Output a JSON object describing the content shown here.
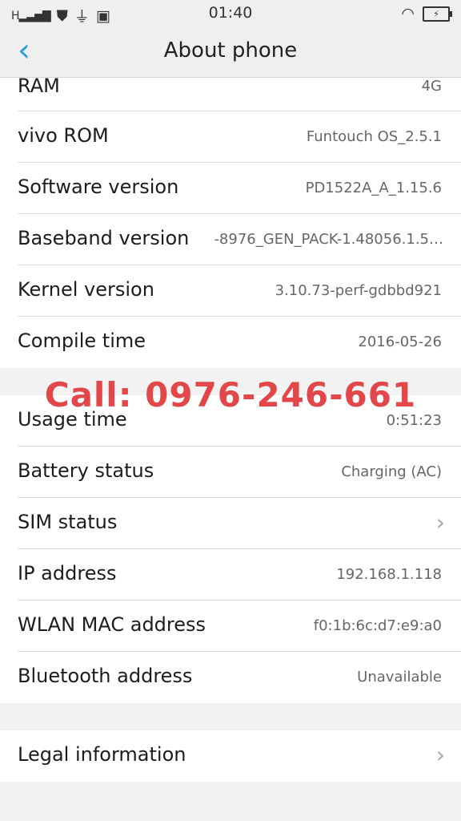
{
  "status_bar": {
    "signal_text": "H",
    "time": "01:40",
    "icons": [
      "signal-icon",
      "shield-icon",
      "usb-icon",
      "battery-saver-icon",
      "wifi-icon",
      "battery-charging-icon"
    ]
  },
  "header": {
    "title": "About phone",
    "back_icon": "chevron-left-icon"
  },
  "rows_top": [
    {
      "label": "RAM",
      "value": "4G"
    },
    {
      "label": "vivo ROM",
      "value": "Funtouch OS_2.5.1"
    },
    {
      "label": "Software version",
      "value": "PD1522A_A_1.15.6"
    },
    {
      "label": "Baseband version",
      "value": "-8976_GEN_PACK-1.48056.1.5…"
    },
    {
      "label": "Kernel version",
      "value": "3.10.73-perf-gdbbd921"
    },
    {
      "label": "Compile time",
      "value": "2016-05-26"
    }
  ],
  "overlay_text": "Call: 0976-246-661",
  "rows_mid": [
    {
      "label": "Usage time",
      "value": "0:51:23"
    },
    {
      "label": "Battery status",
      "value": "Charging (AC)"
    },
    {
      "label": "SIM status",
      "value": "",
      "chevron": true
    },
    {
      "label": "IP address",
      "value": "192.168.1.118"
    },
    {
      "label": "WLAN MAC address",
      "value": "f0:1b:6c:d7:e9:a0"
    },
    {
      "label": "Bluetooth address",
      "value": "Unavailable"
    }
  ],
  "rows_bottom": [
    {
      "label": "Legal information",
      "value": "",
      "chevron": true
    }
  ],
  "colors": {
    "accent": "#2a9fd8",
    "overlay": "#e2474a",
    "background": "#f2f2f2"
  }
}
